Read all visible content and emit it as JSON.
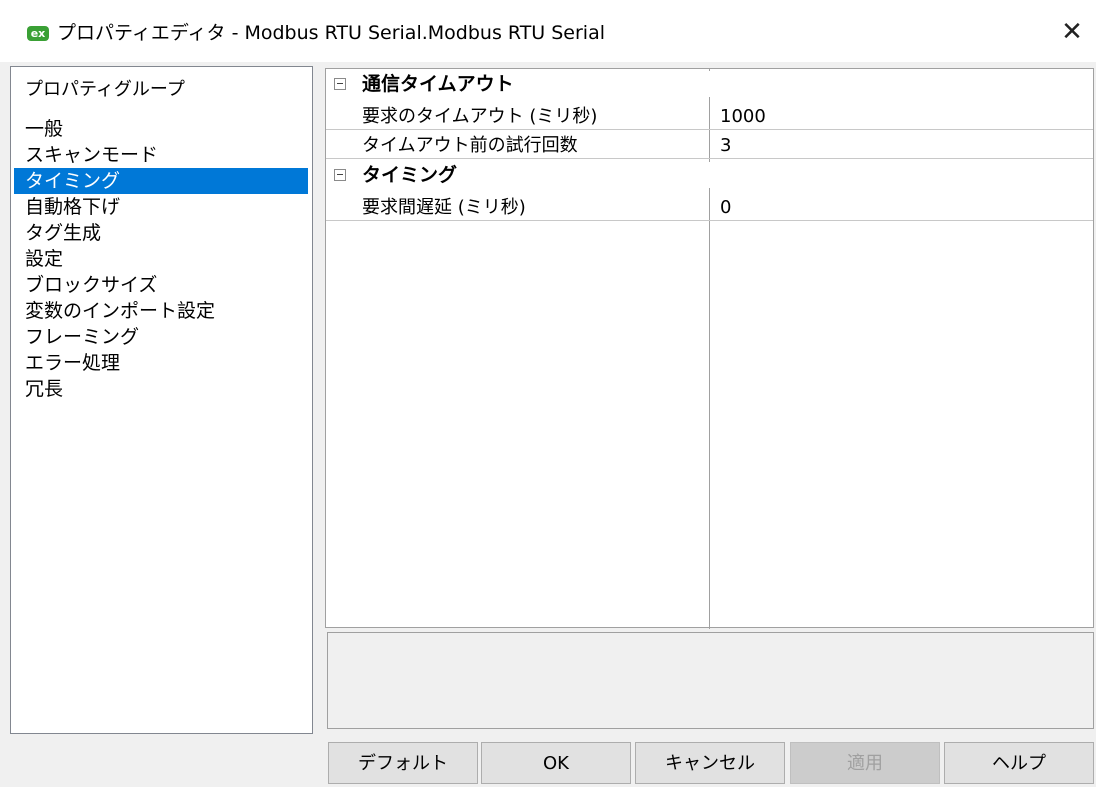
{
  "window": {
    "title": "プロパティエディタ - Modbus RTU Serial.Modbus RTU Serial",
    "app_icon": "ex"
  },
  "nav": {
    "header": "プロパティグループ",
    "items": [
      {
        "label": "一般"
      },
      {
        "label": "スキャンモード"
      },
      {
        "label": "タイミング",
        "selected": true
      },
      {
        "label": "自動格下げ"
      },
      {
        "label": "タグ生成"
      },
      {
        "label": "設定"
      },
      {
        "label": "ブロックサイズ"
      },
      {
        "label": "変数のインポート設定"
      },
      {
        "label": "フレーミング"
      },
      {
        "label": "エラー処理"
      },
      {
        "label": "冗長"
      }
    ],
    "selection_color": "#0078d7"
  },
  "grid": {
    "categories": [
      {
        "label": "通信タイムアウト",
        "properties": [
          {
            "name": "要求のタイムアウト (ミリ秒)",
            "value": "1000"
          },
          {
            "name": "タイムアウト前の試行回数",
            "value": "3"
          }
        ]
      },
      {
        "label": "タイミング",
        "properties": [
          {
            "name": "要求間遅延 (ミリ秒)",
            "value": "0"
          }
        ]
      }
    ]
  },
  "buttons": {
    "default": "デフォルト",
    "ok": "OK",
    "cancel": "キャンセル",
    "apply": "適用",
    "help": "ヘルプ"
  }
}
